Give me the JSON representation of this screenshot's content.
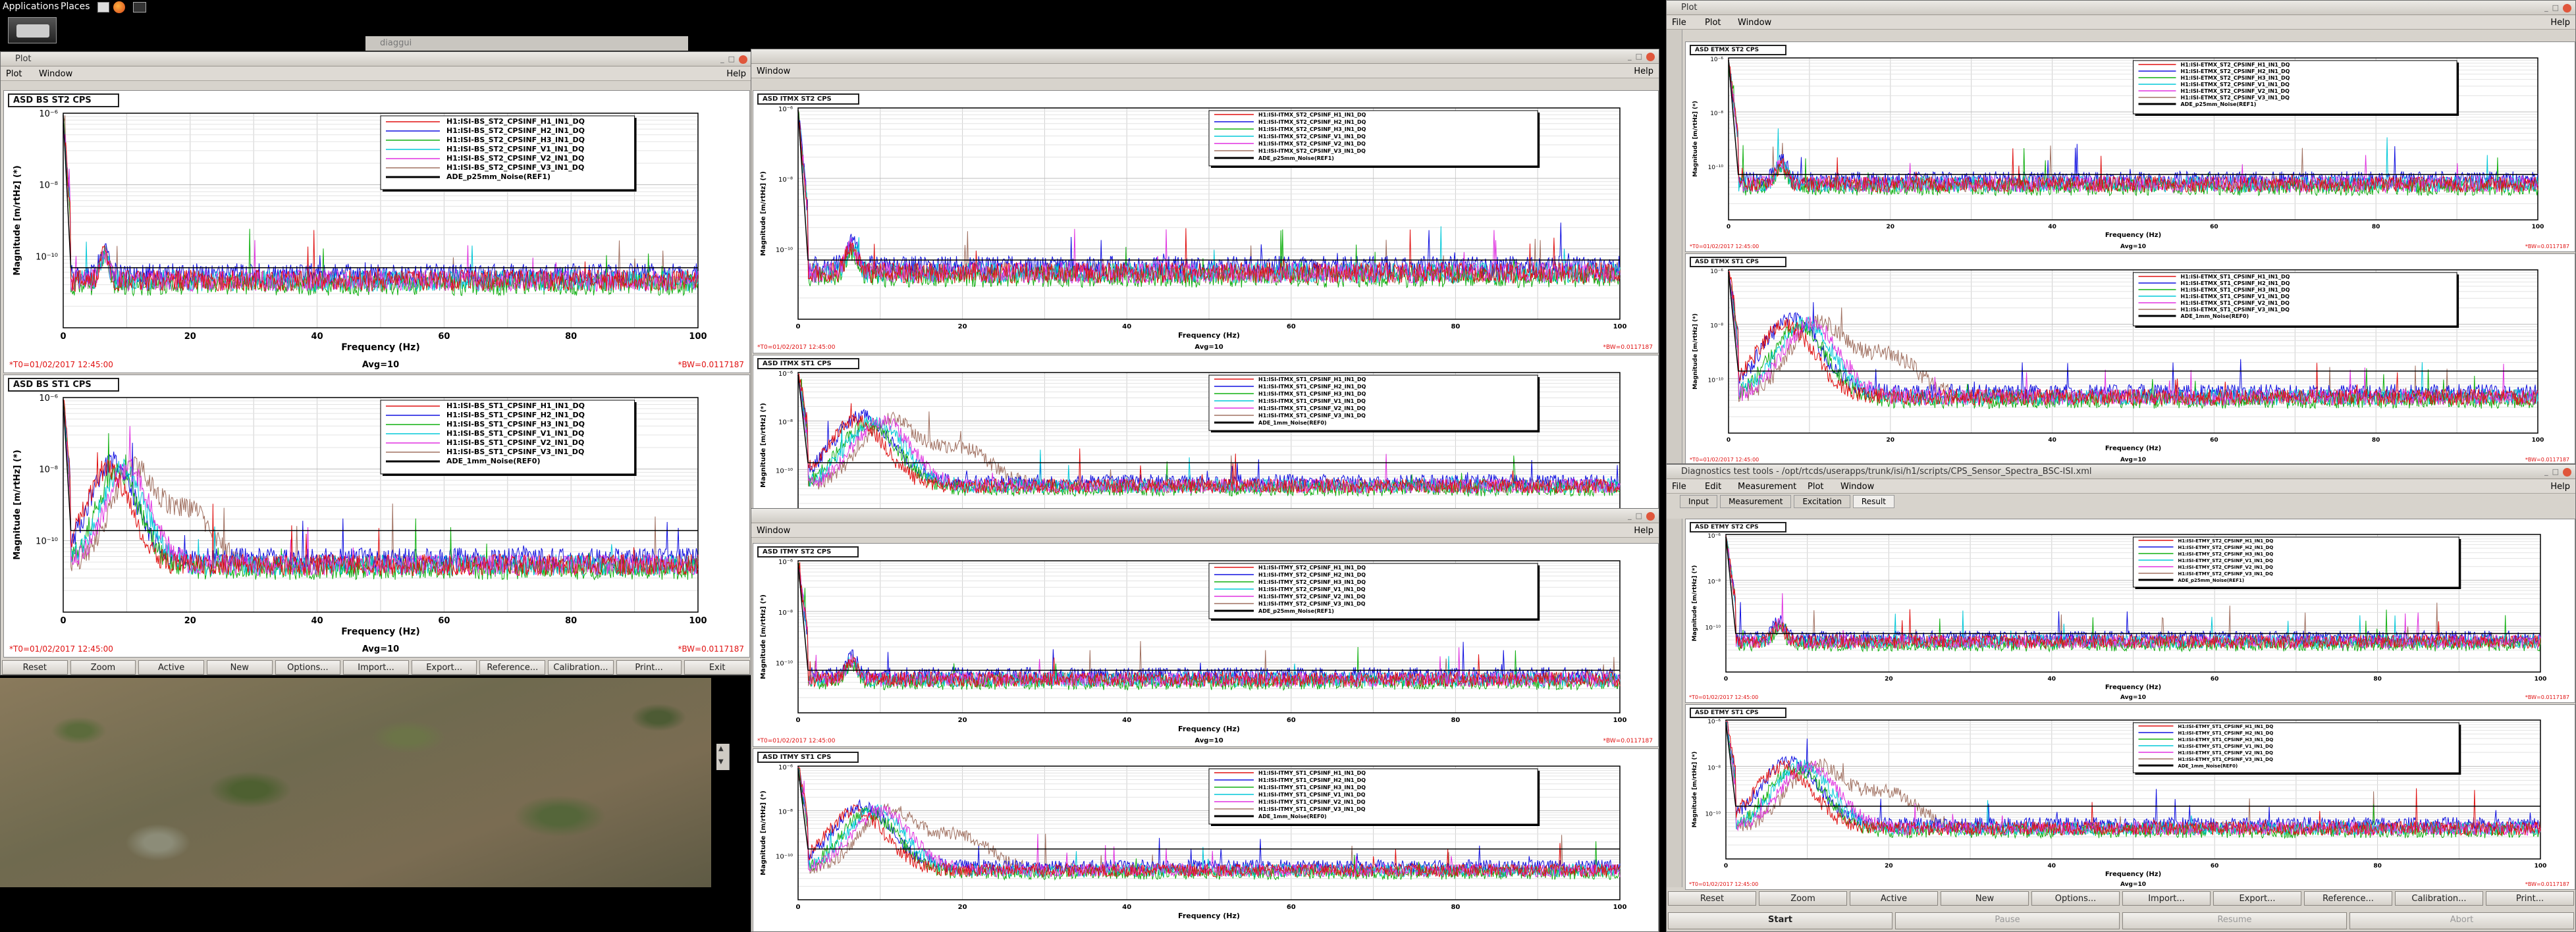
{
  "desktop": {
    "applications": "Applications",
    "places": "Places"
  },
  "background_window_title": "diaggui",
  "left_window": {
    "title": "Plot",
    "menus": [
      "Plot",
      "Window"
    ],
    "help": "Help",
    "buttons": [
      "Reset",
      "Zoom",
      "Active",
      "New",
      "Options...",
      "Import...",
      "Export...",
      "Reference...",
      "Calibration...",
      "Print...",
      "Exit"
    ]
  },
  "mid_top_window": {
    "menus": [
      "Window"
    ],
    "help": "Help"
  },
  "mid_bottom_window": {
    "menus": [
      "Window"
    ],
    "help": "Help"
  },
  "right_top_window": {
    "title": "Plot",
    "menus": [
      "File",
      "Plot",
      "Window"
    ],
    "help": "Help"
  },
  "right_bottom_window": {
    "title": "Diagnostics test tools - /opt/rtcds/userapps/trunk/isi/h1/scripts/CPS_Sensor_Spectra_BSC-ISI.xml",
    "menus": [
      "File",
      "Edit",
      "Measurement",
      "Plot",
      "Window"
    ],
    "help": "Help",
    "tabs": [
      "Input",
      "Measurement",
      "Excitation",
      "Result"
    ],
    "buttons": [
      "Reset",
      "Zoom",
      "Active",
      "New",
      "Options...",
      "Import...",
      "Export...",
      "Reference...",
      "Calibration...",
      "Print..."
    ],
    "actions": [
      "Start",
      "Pause",
      "Resume",
      "Abort"
    ]
  },
  "colors": {
    "series": [
      "#e01010",
      "#1010e0",
      "#10b010",
      "#00c8d8",
      "#e030e0",
      "#a07060",
      "#000000"
    ],
    "grid": "#c8c8c8"
  },
  "plots": [
    {
      "title": "ASD BS ST2 CPS",
      "ylabel": "Magnitude [m/rtHz] (*)",
      "xlabel": "Frequency (Hz)",
      "yticks": [
        "10⁻⁶",
        "10⁻⁸",
        "10⁻¹⁰"
      ],
      "xticks": [
        "0",
        "20",
        "40",
        "60",
        "80",
        "100"
      ],
      "legend": [
        "H1:ISI-BS_ST2_CPSINF_H1_IN1_DQ",
        "H1:ISI-BS_ST2_CPSINF_H2_IN1_DQ",
        "H1:ISI-BS_ST2_CPSINF_H3_IN1_DQ",
        "H1:ISI-BS_ST2_CPSINF_V1_IN1_DQ",
        "H1:ISI-BS_ST2_CPSINF_V2_IN1_DQ",
        "H1:ISI-BS_ST2_CPSINF_V3_IN1_DQ",
        "ADE_p25mm_Noise(REF1)"
      ],
      "t0": "*T0=01/02/2017 12:45:00",
      "avg": "Avg=10",
      "bw": "*BW=0.0117187"
    },
    {
      "title": "ASD BS ST1 CPS",
      "ylabel": "Magnitude [m/rtHz] (*)",
      "xlabel": "Frequency (Hz)",
      "yticks": [
        "10⁻⁶",
        "10⁻⁸",
        "10⁻¹⁰"
      ],
      "xticks": [
        "0",
        "20",
        "40",
        "60",
        "80",
        "100"
      ],
      "legend": [
        "H1:ISI-BS_ST1_CPSINF_H1_IN1_DQ",
        "H1:ISI-BS_ST1_CPSINF_H2_IN1_DQ",
        "H1:ISI-BS_ST1_CPSINF_H3_IN1_DQ",
        "H1:ISI-BS_ST1_CPSINF_V1_IN1_DQ",
        "H1:ISI-BS_ST1_CPSINF_V2_IN1_DQ",
        "H1:ISI-BS_ST1_CPSINF_V3_IN1_DQ",
        "ADE_1mm_Noise(REF0)"
      ],
      "t0": "*T0=01/02/2017 12:45:00",
      "avg": "Avg=10",
      "bw": "*BW=0.0117187"
    },
    {
      "title": "ASD ITMX ST2 CPS",
      "ylabel": "Magnitude [m/rtHz] (*)",
      "xlabel": "Frequency (Hz)",
      "yticks": [
        "10⁻⁶",
        "10⁻⁸",
        "10⁻¹⁰"
      ],
      "xticks": [
        "0",
        "20",
        "40",
        "60",
        "80",
        "100"
      ],
      "legend": [
        "H1:ISI-ITMX_ST2_CPSINF_H1_IN1_DQ",
        "H1:ISI-ITMX_ST2_CPSINF_H2_IN1_DQ",
        "H1:ISI-ITMX_ST2_CPSINF_H3_IN1_DQ",
        "H1:ISI-ITMX_ST2_CPSINF_V1_IN1_DQ",
        "H1:ISI-ITMX_ST2_CPSINF_V2_IN1_DQ",
        "H1:ISI-ITMX_ST2_CPSINF_V3_IN1_DQ",
        "ADE_p25mm_Noise(REF1)"
      ],
      "t0": "*T0=01/02/2017 12:45:00",
      "avg": "Avg=10",
      "bw": "*BW=0.0117187"
    },
    {
      "title": "ASD ITMX ST1 CPS",
      "ylabel": "Magnitude [m/rtHz] (*)",
      "xlabel": "Frequency (Hz)",
      "yticks": [
        "10⁻⁶",
        "10⁻⁸",
        "10⁻¹⁰"
      ],
      "xticks": [
        "0",
        "20",
        "40",
        "60",
        "80",
        "100"
      ],
      "legend": [
        "H1:ISI-ITMX_ST1_CPSINF_H1_IN1_DQ",
        "H1:ISI-ITMX_ST1_CPSINF_H2_IN1_DQ",
        "H1:ISI-ITMX_ST1_CPSINF_H3_IN1_DQ",
        "H1:ISI-ITMX_ST1_CPSINF_V1_IN1_DQ",
        "H1:ISI-ITMX_ST1_CPSINF_V2_IN1_DQ",
        "H1:ISI-ITMX_ST1_CPSINF_V3_IN1_DQ",
        "ADE_1mm_Noise(REF0)"
      ],
      "t0": "",
      "avg": "",
      "bw": ""
    },
    {
      "title": "ASD ITMY ST2 CPS",
      "ylabel": "Magnitude [m/rtHz] (*)",
      "xlabel": "Frequency (Hz)",
      "yticks": [
        "10⁻⁶",
        "10⁻⁸",
        "10⁻¹⁰"
      ],
      "xticks": [
        "0",
        "20",
        "40",
        "60",
        "80",
        "100"
      ],
      "legend": [
        "H1:ISI-ITMY_ST2_CPSINF_H1_IN1_DQ",
        "H1:ISI-ITMY_ST2_CPSINF_H2_IN1_DQ",
        "H1:ISI-ITMY_ST2_CPSINF_H3_IN1_DQ",
        "H1:ISI-ITMY_ST2_CPSINF_V1_IN1_DQ",
        "H1:ISI-ITMY_ST2_CPSINF_V2_IN1_DQ",
        "H1:ISI-ITMY_ST2_CPSINF_V3_IN1_DQ",
        "ADE_p25mm_Noise(REF1)"
      ],
      "t0": "*T0=01/02/2017 12:45:00",
      "avg": "Avg=10",
      "bw": "*BW=0.0117187"
    },
    {
      "title": "ASD ITMY ST1 CPS",
      "ylabel": "Magnitude [m/rtHz] (*)",
      "xlabel": "Frequency (Hz)",
      "yticks": [
        "10⁻⁶",
        "10⁻⁸",
        "10⁻¹⁰"
      ],
      "xticks": [
        "0",
        "20",
        "40",
        "60",
        "80",
        "100"
      ],
      "legend": [
        "H1:ISI-ITMY_ST1_CPSINF_H1_IN1_DQ",
        "H1:ISI-ITMY_ST1_CPSINF_H2_IN1_DQ",
        "H1:ISI-ITMY_ST1_CPSINF_H3_IN1_DQ",
        "H1:ISI-ITMY_ST1_CPSINF_V1_IN1_DQ",
        "H1:ISI-ITMY_ST1_CPSINF_V2_IN1_DQ",
        "H1:ISI-ITMY_ST1_CPSINF_V3_IN1_DQ",
        "ADE_1mm_Noise(REF0)"
      ],
      "t0": "",
      "avg": "",
      "bw": ""
    },
    {
      "title": "ASD ETMX ST2 CPS",
      "ylabel": "Magnitude [m/rtHz] (*)",
      "xlabel": "Frequency (Hz)",
      "yticks": [
        "10⁻⁶",
        "10⁻⁸",
        "10⁻¹⁰"
      ],
      "xticks": [
        "0",
        "20",
        "40",
        "60",
        "80",
        "100"
      ],
      "legend": [
        "H1:ISI-ETMX_ST2_CPSINF_H1_IN1_DQ",
        "H1:ISI-ETMX_ST2_CPSINF_H2_IN1_DQ",
        "H1:ISI-ETMX_ST2_CPSINF_H3_IN1_DQ",
        "H1:ISI-ETMX_ST2_CPSINF_V1_IN1_DQ",
        "H1:ISI-ETMX_ST2_CPSINF_V2_IN1_DQ",
        "H1:ISI-ETMX_ST2_CPSINF_V3_IN1_DQ",
        "ADE_p25mm_Noise(REF1)"
      ],
      "t0": "*T0=01/02/2017 12:45:00",
      "avg": "Avg=10",
      "bw": "*BW=0.0117187"
    },
    {
      "title": "ASD ETMX ST1 CPS",
      "ylabel": "Magnitude [m/rtHz] (*)",
      "xlabel": "Frequency (Hz)",
      "yticks": [
        "10⁻⁶",
        "10⁻⁸",
        "10⁻¹⁰"
      ],
      "xticks": [
        "0",
        "20",
        "40",
        "60",
        "80",
        "100"
      ],
      "legend": [
        "H1:ISI-ETMX_ST1_CPSINF_H1_IN1_DQ",
        "H1:ISI-ETMX_ST1_CPSINF_H2_IN1_DQ",
        "H1:ISI-ETMX_ST1_CPSINF_H3_IN1_DQ",
        "H1:ISI-ETMX_ST1_CPSINF_V1_IN1_DQ",
        "H1:ISI-ETMX_ST1_CPSINF_V2_IN1_DQ",
        "H1:ISI-ETMX_ST1_CPSINF_V3_IN1_DQ",
        "ADE_1mm_Noise(REF0)"
      ],
      "t0": "*T0=01/02/2017 12:45:00",
      "avg": "Avg=10",
      "bw": "*BW=0.0117187"
    },
    {
      "title": "ASD ETMY ST2 CPS",
      "ylabel": "Magnitude [m/rtHz] (*)",
      "xlabel": "Frequency (Hz)",
      "yticks": [
        "10⁻⁶",
        "10⁻⁸",
        "10⁻¹⁰"
      ],
      "xticks": [
        "0",
        "20",
        "40",
        "60",
        "80",
        "100"
      ],
      "legend": [
        "H1:ISI-ETMY_ST2_CPSINF_H1_IN1_DQ",
        "H1:ISI-ETMY_ST2_CPSINF_H2_IN1_DQ",
        "H1:ISI-ETMY_ST2_CPSINF_H3_IN1_DQ",
        "H1:ISI-ETMY_ST2_CPSINF_V1_IN1_DQ",
        "H1:ISI-ETMY_ST2_CPSINF_V2_IN1_DQ",
        "H1:ISI-ETMY_ST2_CPSINF_V3_IN1_DQ",
        "ADE_p25mm_Noise(REF1)"
      ],
      "t0": "*T0=01/02/2017 12:45:00",
      "avg": "Avg=10",
      "bw": "*BW=0.0117187"
    },
    {
      "title": "ASD ETMY ST1 CPS",
      "ylabel": "Magnitude [m/rtHz] (*)",
      "xlabel": "Frequency (Hz)",
      "yticks": [
        "10⁻⁶",
        "10⁻⁸",
        "10⁻¹⁰"
      ],
      "xticks": [
        "0",
        "20",
        "40",
        "60",
        "80",
        "100"
      ],
      "legend": [
        "H1:ISI-ETMY_ST1_CPSINF_H1_IN1_DQ",
        "H1:ISI-ETMY_ST1_CPSINF_H2_IN1_DQ",
        "H1:ISI-ETMY_ST1_CPSINF_H3_IN1_DQ",
        "H1:ISI-ETMY_ST1_CPSINF_V1_IN1_DQ",
        "H1:ISI-ETMY_ST1_CPSINF_V2_IN1_DQ",
        "H1:ISI-ETMY_ST1_CPSINF_V3_IN1_DQ",
        "ADE_1mm_Noise(REF0)"
      ],
      "t0": "*T0=01/02/2017 12:45:00",
      "avg": "Avg=10",
      "bw": "*BW=0.0117187"
    }
  ]
}
